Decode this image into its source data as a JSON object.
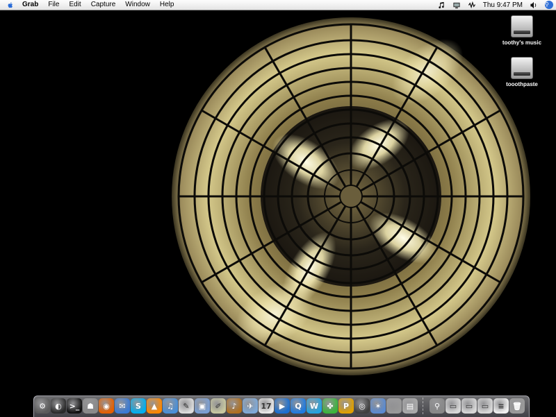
{
  "menubar": {
    "app_name": "Grab",
    "menus": [
      "File",
      "Edit",
      "Capture",
      "Window",
      "Help"
    ],
    "clock": "Thu 9:47 PM",
    "status_icons": [
      "music-note-icon",
      "display-icon",
      "waveform-icon",
      "volume-icon",
      "spotlight-icon"
    ]
  },
  "desktop": {
    "icons": [
      {
        "label": "toothy's music",
        "icon": "hard-drive-icon"
      },
      {
        "label": "tooothpaste",
        "icon": "hard-drive-icon"
      }
    ]
  },
  "dock": {
    "apps": [
      {
        "name": "app-launcher",
        "color": "#5a5a5a",
        "glyph": "⚙"
      },
      {
        "name": "dashboard",
        "color": "#2b2b2b",
        "glyph": "◐"
      },
      {
        "name": "terminal",
        "color": "#111111",
        "glyph": ">_"
      },
      {
        "name": "automator",
        "color": "#8a8a8a",
        "glyph": "☗"
      },
      {
        "name": "firefox",
        "color": "#e66000",
        "glyph": "◉"
      },
      {
        "name": "ichat",
        "color": "#3a7bd5",
        "glyph": "✉"
      },
      {
        "name": "skype",
        "color": "#00aff0",
        "glyph": "S"
      },
      {
        "name": "vlc",
        "color": "#ff8800",
        "glyph": "▲"
      },
      {
        "name": "itunes",
        "color": "#4a90d9",
        "glyph": "♫"
      },
      {
        "name": "textedit",
        "color": "#dddddd",
        "glyph": "✎"
      },
      {
        "name": "iphoto",
        "color": "#7a9fd4",
        "glyph": "▣"
      },
      {
        "name": "script-editor",
        "color": "#c8c8a0",
        "glyph": "✐"
      },
      {
        "name": "garageband",
        "color": "#b07020",
        "glyph": "♪"
      },
      {
        "name": "mail",
        "color": "#7faad8",
        "glyph": "✈"
      },
      {
        "name": "ical",
        "color": "#e8e8e8",
        "glyph": "17"
      },
      {
        "name": "quicktime",
        "color": "#1a6fd1",
        "glyph": "▶"
      },
      {
        "name": "q-app",
        "color": "#1f7be0",
        "glyph": "Q"
      },
      {
        "name": "w-app",
        "color": "#23a3e0",
        "glyph": "W"
      },
      {
        "name": "frog-app",
        "color": "#3cb43c",
        "glyph": "✤"
      },
      {
        "name": "p-app",
        "color": "#e0a000",
        "glyph": "P"
      },
      {
        "name": "cd-app",
        "color": "#404040",
        "glyph": "◎"
      },
      {
        "name": "network-app",
        "color": "#5a8ad0",
        "glyph": "✶"
      },
      {
        "name": "finder-app",
        "color": "#999999",
        "glyph": ""
      },
      {
        "name": "preview-app",
        "color": "#aaaaaa",
        "glyph": "▤"
      }
    ],
    "docs": [
      {
        "name": "stack-app",
        "color": "#888888",
        "glyph": "⚲"
      },
      {
        "name": "window-1",
        "color": "#d8d8d8",
        "glyph": "▭"
      },
      {
        "name": "window-2",
        "color": "#d8d8d8",
        "glyph": "▭"
      },
      {
        "name": "window-3",
        "color": "#d8d8d8",
        "glyph": "▭"
      },
      {
        "name": "document",
        "color": "#f0f0f0",
        "glyph": "≡"
      },
      {
        "name": "trash",
        "color": "#9a9a9a",
        "glyph": "🗑"
      }
    ]
  }
}
